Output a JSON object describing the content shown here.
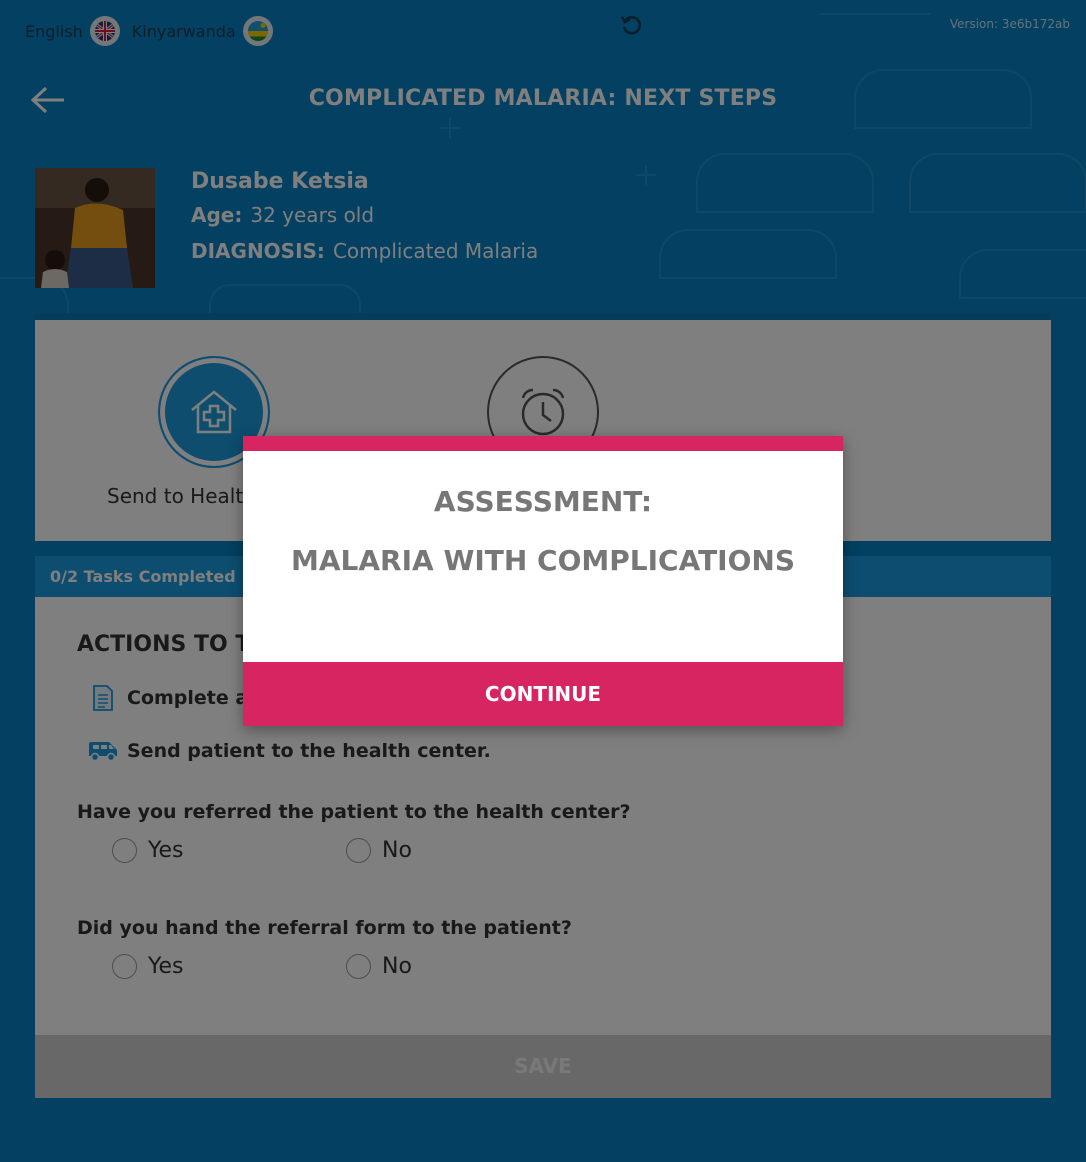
{
  "colors": {
    "header_blue": "#0680c2",
    "accent_blue": "#1a9ae0",
    "modal_accent": "#d72561",
    "text_dark": "#333333"
  },
  "header": {
    "languages": [
      {
        "label": "English",
        "flag": "uk-flag-icon"
      },
      {
        "label": "Kinyarwanda",
        "flag": "rwanda-flag-icon"
      }
    ],
    "version": "Version: 3e6b172ab",
    "title": "COMPLICATED MALARIA: NEXT STEPS",
    "back_icon": "back-arrow-icon",
    "reload_icon": "reload-icon"
  },
  "patient": {
    "name": "Dusabe Ketsia",
    "age_label": "Age:",
    "age": "32 years old",
    "diagnosis_label": "DIAGNOSIS:",
    "diagnosis": "Complicated Malaria"
  },
  "actions": [
    {
      "label": "Send to Health",
      "icon": "health-house-icon"
    },
    {
      "label": "",
      "icon": "alarm-clock-icon"
    }
  ],
  "tasks": {
    "progress": "0/2 Tasks Completed",
    "section_title": "ACTIONS TO TA",
    "items": [
      {
        "icon": "document-icon",
        "text": "Complete a"
      },
      {
        "icon": "ambulance-icon",
        "text": "Send patient to the health center."
      }
    ],
    "questions": [
      {
        "text": "Have you referred the patient to the health center?",
        "options": [
          "Yes",
          "No"
        ]
      },
      {
        "text": "Did you hand the referral form to the patient?",
        "options": [
          "Yes",
          "No"
        ]
      }
    ],
    "save_label": "SAVE"
  },
  "modal": {
    "title": "ASSESSMENT:",
    "subtitle": "MALARIA WITH COMPLICATIONS",
    "button": "CONTINUE"
  }
}
